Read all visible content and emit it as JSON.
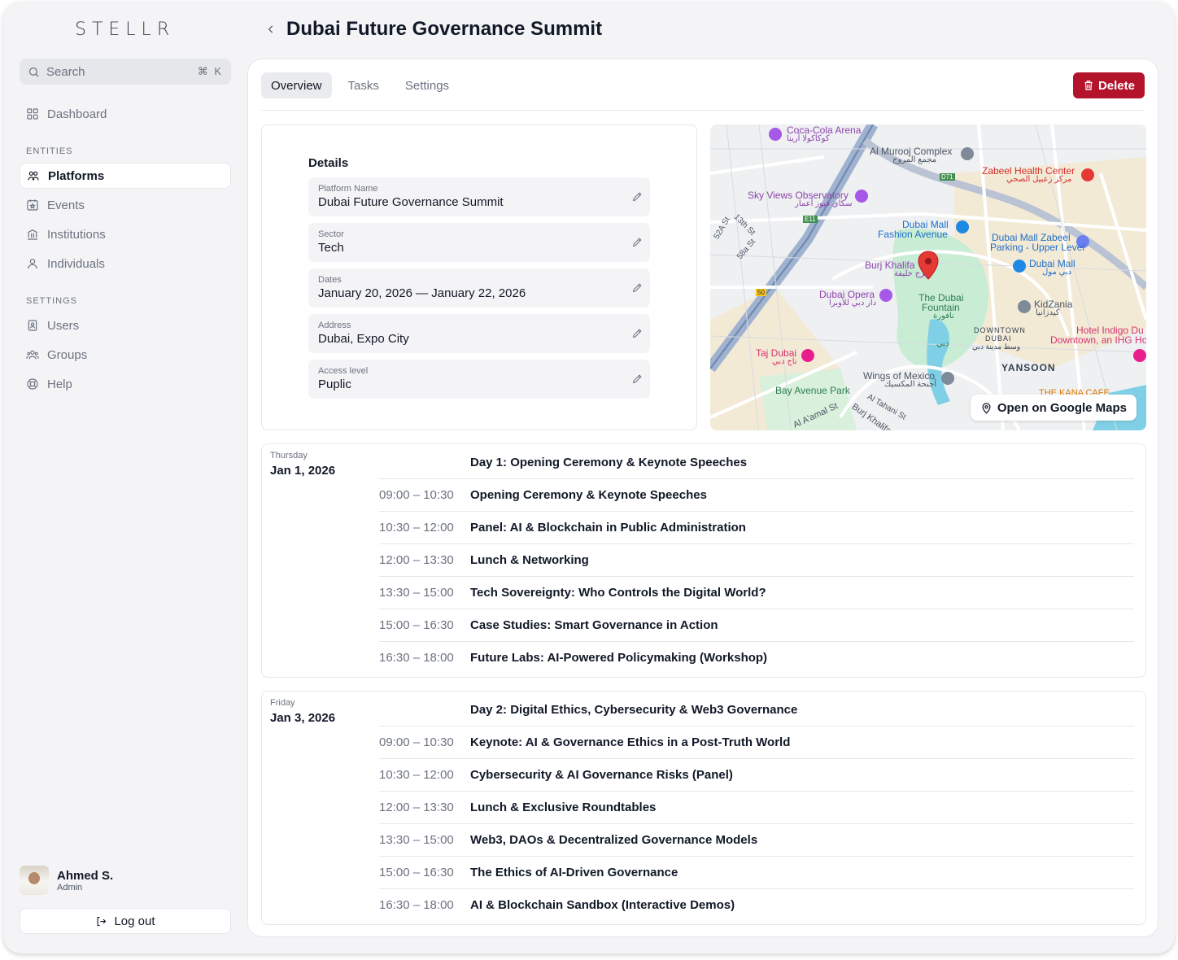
{
  "app": {
    "logo": "STELLR"
  },
  "search": {
    "placeholder": "Search",
    "shortcut": "⌘ K"
  },
  "sidebar": {
    "dashboard": "Dashboard",
    "entities_label": "ENTITIES",
    "entities": [
      "Platforms",
      "Events",
      "Institutions",
      "Individuals"
    ],
    "settings_label": "SETTINGS",
    "settings": [
      "Users",
      "Groups",
      "Help"
    ]
  },
  "user": {
    "name": "Ahmed S.",
    "role": "Admin",
    "logout": "Log out"
  },
  "header": {
    "title": "Dubai Future Governance Summit"
  },
  "tabs": [
    "Overview",
    "Tasks",
    "Settings"
  ],
  "actions": {
    "delete": "Delete"
  },
  "details": {
    "title": "Details",
    "fields": [
      {
        "label": "Platform Name",
        "value": "Dubai Future Governance Summit"
      },
      {
        "label": "Sector",
        "value": "Tech"
      },
      {
        "label": "Dates",
        "value": "January 20, 2026 — January 22, 2026"
      },
      {
        "label": "Address",
        "value": "Dubai, Expo City"
      },
      {
        "label": "Access level",
        "value": "Puplic"
      }
    ]
  },
  "map": {
    "open_button": "Open on Google Maps",
    "labels": [
      "Coca-Cola Arena",
      "كوكاكولا أرينا",
      "Al Murooj Complex",
      "مجمع المروج",
      "Zabeel Health Center",
      "مركز زعبيل الصحي",
      "Sky Views Observatory",
      "سكاي فيوز أعمار",
      "Dubai Mall",
      "Fashion Avenue",
      "Dubai Mall Zabeel",
      "Parking - Upper Level",
      "Burj Khalifa",
      "برج خليفة",
      "Dubai Mall",
      "دبي مول",
      "Dubai Opera",
      "دار دبي للأوبرا",
      "The Dubai",
      "Fountain",
      "نافورة",
      "دبي",
      "KidZania",
      "كيدزانيا",
      "DOWNTOWN",
      "DUBAI",
      "وسط مدينة دبي",
      "Hotel Indigo Du",
      "Downtown, an IHG Ho",
      "Taj Dubai",
      "تاج دبي",
      "YANSOON",
      "Wings of Mexico",
      "أجنحة المكسيك",
      "Bay Avenue Park",
      "THE KANA CAFE",
      "13th St",
      "52A St",
      "58a St",
      "Al Tahani St",
      "Al A'amal St",
      "Burj Khalifa",
      "D71",
      "E11",
      "50"
    ]
  },
  "schedule": [
    {
      "weekday": "Thursday",
      "date": "Jan 1, 2026",
      "title": "Day 1: Opening Ceremony & Keynote Speeches",
      "sessions": [
        {
          "time": "09:00 – 10:30",
          "name": "Opening Ceremony & Keynote Speeches"
        },
        {
          "time": "10:30 – 12:00",
          "name": "Panel: AI & Blockchain in Public Administration"
        },
        {
          "time": "12:00 – 13:30",
          "name": "Lunch & Networking"
        },
        {
          "time": "13:30 – 15:00",
          "name": "Tech Sovereignty: Who Controls the Digital World?"
        },
        {
          "time": "15:00 – 16:30",
          "name": "Case Studies: Smart Governance in Action"
        },
        {
          "time": "16:30 – 18:00",
          "name": "Future Labs: AI-Powered Policymaking (Workshop)"
        }
      ]
    },
    {
      "weekday": "Friday",
      "date": "Jan 3, 2026",
      "title": "Day 2: Digital Ethics, Cybersecurity & Web3 Governance",
      "sessions": [
        {
          "time": "09:00 – 10:30",
          "name": "Keynote: AI & Governance Ethics in a Post-Truth World"
        },
        {
          "time": "10:30 – 12:00",
          "name": "Cybersecurity & AI Governance Risks (Panel)"
        },
        {
          "time": "12:00 – 13:30",
          "name": "Lunch & Exclusive Roundtables"
        },
        {
          "time": "13:30 – 15:00",
          "name": "Web3, DAOs & Decentralized Governance Models"
        },
        {
          "time": "15:00 – 16:30",
          "name": "The Ethics of AI-Driven Governance"
        },
        {
          "time": "16:30 – 18:00",
          "name": "AI & Blockchain Sandbox (Interactive Demos)"
        }
      ]
    }
  ],
  "colors": {
    "accent": "#b3132b",
    "bg": "#f4f4f6",
    "park": "#c8ecd4",
    "water": "#7fd0e6",
    "pin": "#e53935"
  }
}
